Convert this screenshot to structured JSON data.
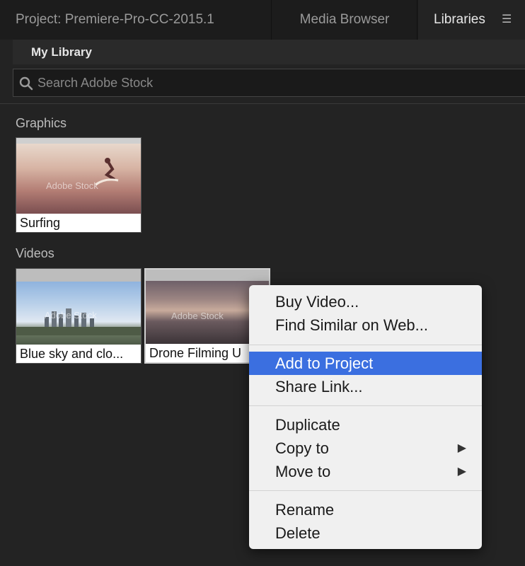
{
  "tabs": {
    "project": "Project: Premiere-Pro-CC-2015.1",
    "media_browser": "Media Browser",
    "libraries": "Libraries"
  },
  "library_selector": "My Library",
  "search": {
    "placeholder": "Search Adobe Stock"
  },
  "graphics": {
    "heading": "Graphics",
    "items": [
      {
        "caption": "Surfing"
      }
    ]
  },
  "videos": {
    "heading": "Videos",
    "items": [
      {
        "caption": "Blue sky and clo..."
      },
      {
        "caption": "Drone Filming U"
      }
    ]
  },
  "watermark": "Adobe Stock",
  "context_menu": {
    "highlighted": "Add to Project",
    "groups": [
      [
        "Buy Video...",
        "Find Similar on Web..."
      ],
      [
        "Add to Project",
        "Share Link..."
      ],
      [
        "Duplicate",
        "Copy to",
        "Move to"
      ],
      [
        "Rename",
        "Delete"
      ]
    ]
  },
  "colors": {
    "highlight": "#3b6fe0",
    "panel_bg": "#232323",
    "tabbar_bg": "#1c1c1c"
  }
}
